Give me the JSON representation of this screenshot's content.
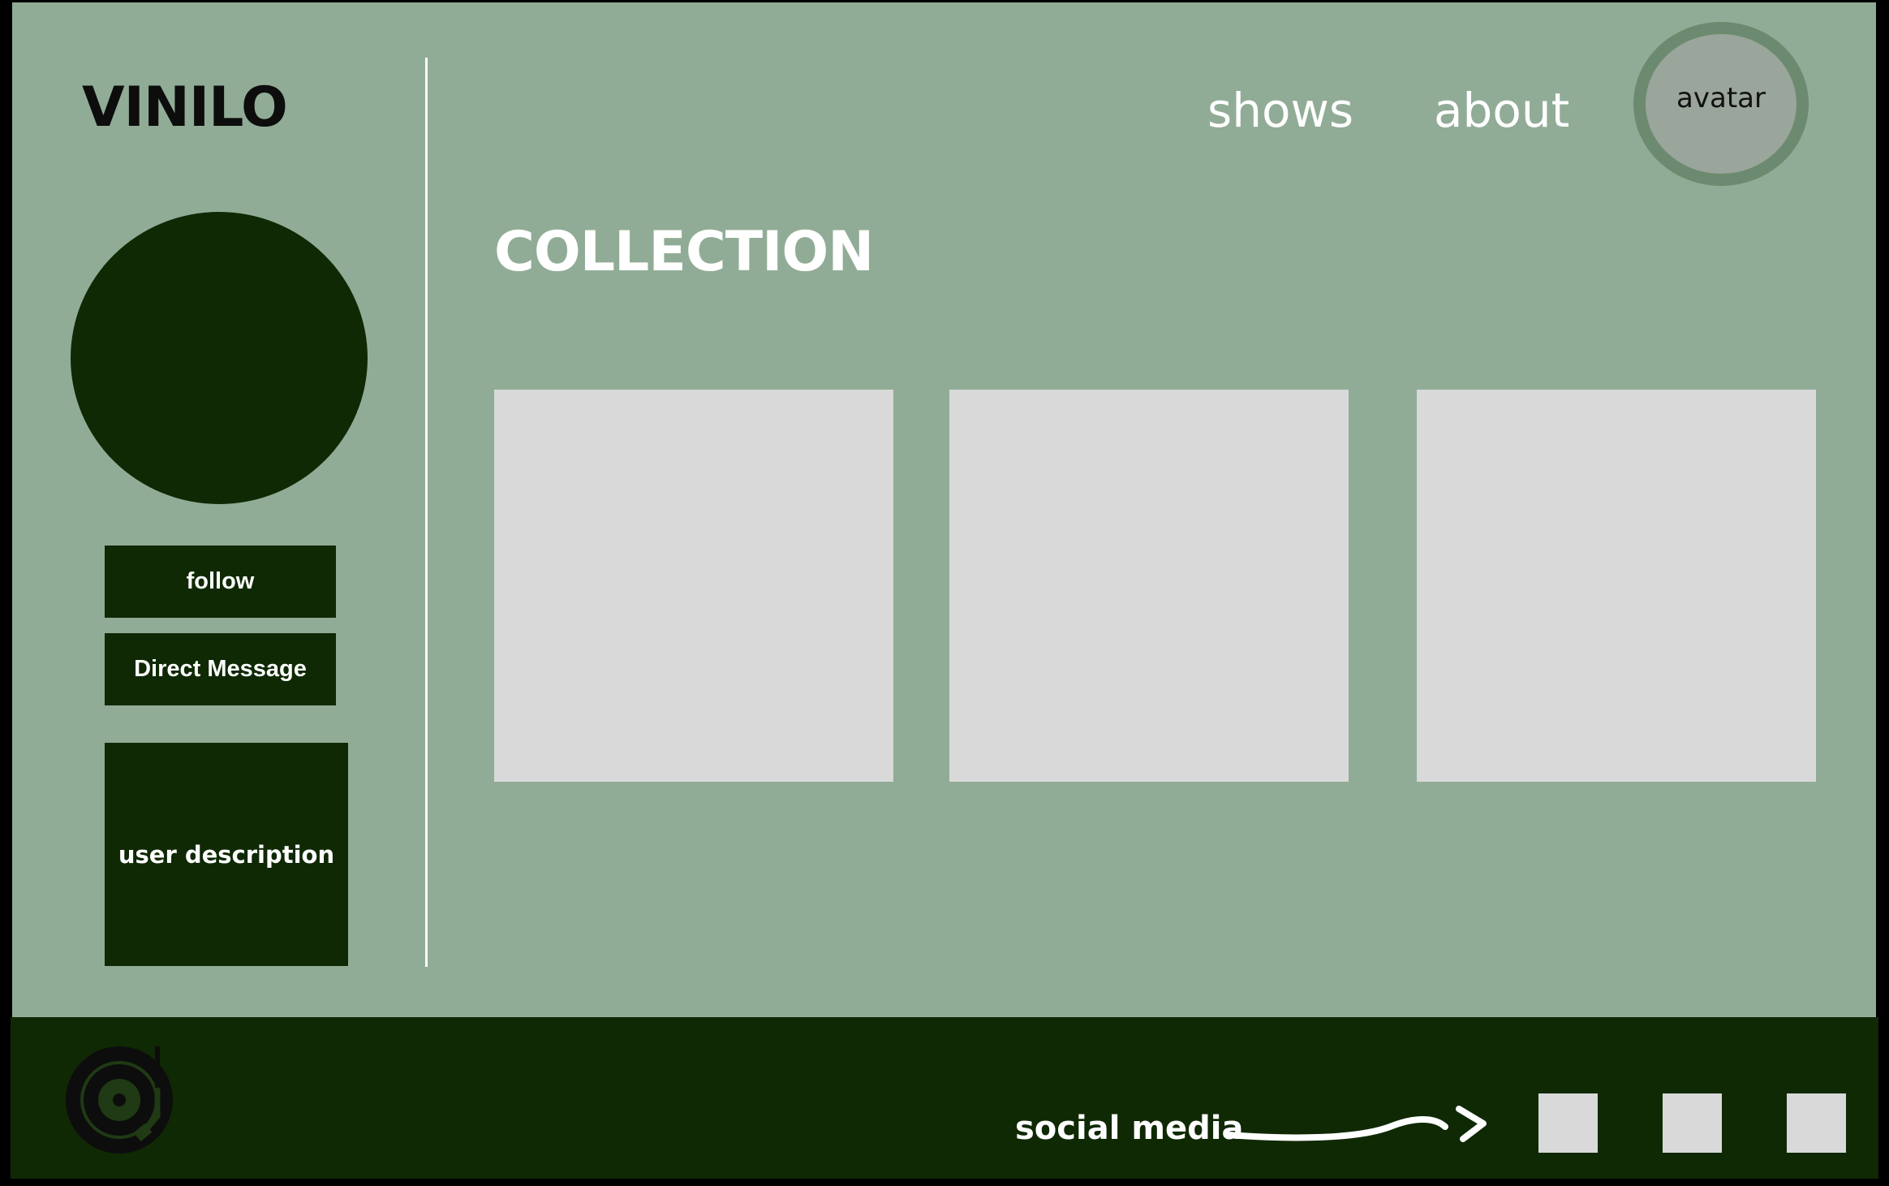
{
  "header": {
    "logo": "VINILO",
    "nav": [
      {
        "label": "shows"
      },
      {
        "label": "about"
      }
    ],
    "avatar_label": "avatar"
  },
  "sidebar": {
    "follow_label": "follow",
    "dm_label": "Direct Message",
    "description": "user description"
  },
  "main": {
    "section_title": "COLLECTION",
    "cards": 3
  },
  "footer": {
    "social_label": "social media",
    "icons": [
      "turntable-icon",
      "arrow-icon"
    ]
  },
  "colors": {
    "background": "#91ac96",
    "dark_green": "#0f2904",
    "card": "#d9d9d9",
    "avatar_ring": "#6c8a6f",
    "avatar_fill": "#9aa59b"
  }
}
